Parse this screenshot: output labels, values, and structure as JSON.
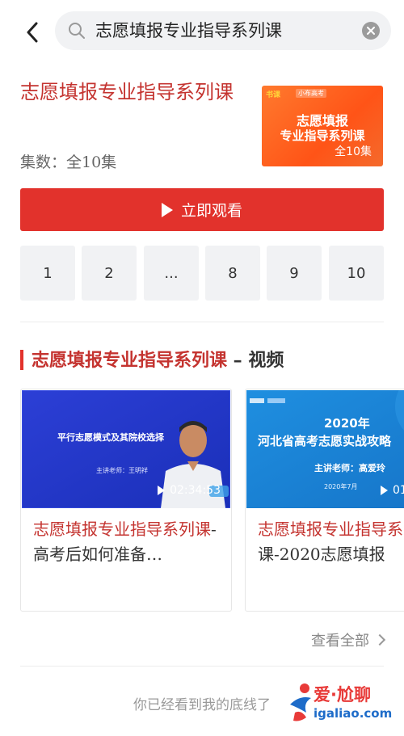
{
  "header": {
    "search_value": "志愿填报专业指导系列课"
  },
  "course": {
    "title": "志愿填报专业指导系列课",
    "episode_count": "集数：全10集",
    "thumbnail": {
      "logo_left": "书课",
      "logo_right": "小布高考",
      "line1": "志愿填报",
      "line2": "专业指导系列课",
      "line3": "全10集"
    },
    "watch_label": "立即观看",
    "episodes": [
      "1",
      "2",
      "...",
      "8",
      "9",
      "10"
    ]
  },
  "section": {
    "title_red": "志愿填报专业指导系列课",
    "title_suffix": " – 视频"
  },
  "videos": [
    {
      "thumb_heading": "平行志愿模式及其院校选择",
      "thumb_teacher": "主讲老师：王明祥",
      "duration": "02:34:53",
      "title_highlight": "志愿填报专业指导系列课",
      "title_rest": "-高考后如何准备…"
    },
    {
      "thumb_year": "2020年",
      "thumb_heading": "河北省高考志愿实战攻略",
      "thumb_teacher": "主讲老师：高爱玲",
      "thumb_date": "2020年7月",
      "duration": "01",
      "title_highlight": "志愿填报专业指导系",
      "title_rest": "课-2020志愿填报"
    }
  ],
  "see_all_label": "查看全部",
  "bottom_note": "你已经看到我的底线了",
  "watermark": {
    "line1": "爱·尬聊",
    "line2": "igaliao.com"
  },
  "colors": {
    "accent": "#e2322c",
    "title_red": "#c4332f"
  }
}
